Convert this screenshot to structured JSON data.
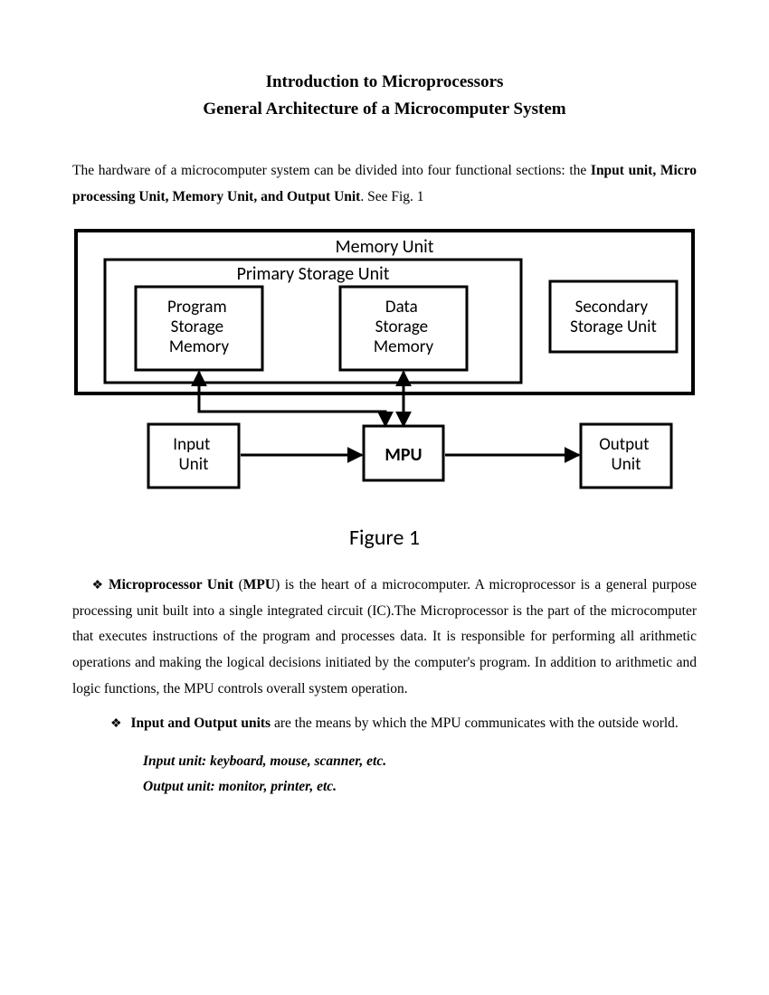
{
  "title": "Introduction to Microprocessors",
  "subtitle": "General Architecture of a Microcomputer System",
  "intro_a": "The hardware of a microcomputer system can be divided into four functional sections: the ",
  "intro_b": "Input unit, Micro processing Unit, Memory Unit, and Output Unit",
  "intro_c": ". See Fig. 1",
  "fig": {
    "memory_unit": "Memory Unit",
    "primary_storage_unit": "Primary Storage Unit",
    "program_storage_memory": "Program Storage Memory",
    "data_storage_memory": "Data Storage Memory",
    "secondary_storage_unit": "Secondary Storage Unit",
    "input_unit": "Input Unit",
    "mpu": "MPU",
    "output_unit": "Output Unit",
    "caption": "Figure 1"
  },
  "mpu_para_lead": "Microprocessor Unit",
  "mpu_para_open": " (",
  "mpu_abbr": "MPU",
  "mpu_para_rest": ") is the heart of a microcomputer. A microprocessor is a general purpose processing unit built into a single integrated circuit (IC).The Microprocessor is the part of the microcomputer that executes instructions of the program and processes data. It is responsible for performing all arithmetic operations and making the logical decisions initiated by the computer's program. In addition to arithmetic and logic functions, the MPU controls overall system operation.",
  "io_bullet_bold": "Input and Output units",
  "io_bullet_rest": " are the means by which the MPU communicates with the outside world.",
  "input_list": "Input unit: keyboard, mouse, scanner, etc.",
  "output_list": "Output unit: monitor, printer, etc.",
  "diamond": "❖"
}
